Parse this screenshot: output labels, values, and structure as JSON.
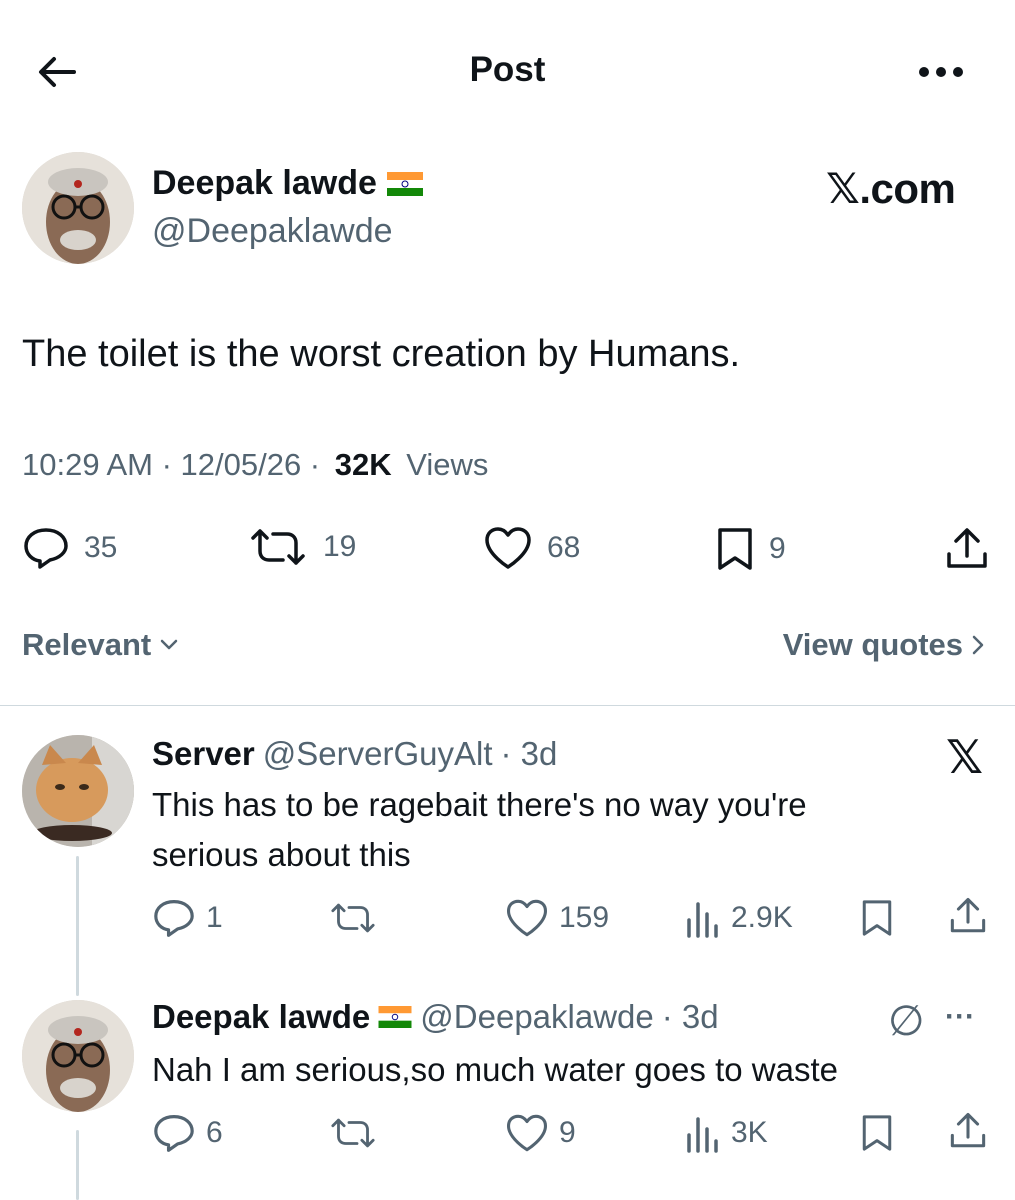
{
  "header": {
    "title": "Post",
    "back_icon": "arrow-left-icon",
    "more_icon": "more-horizontal-icon"
  },
  "post": {
    "author_name": "Deepak lawde",
    "handle": "@Deepaklawde",
    "flag": "india-flag",
    "brand": "𝕏.com",
    "text": "The toilet is the worst creation by Humans.",
    "time": "10:29 AM · 12/05/26 · ",
    "views_count": "32K",
    "views_label": " Views",
    "stats": {
      "replies": "35",
      "reposts": "19",
      "likes": "68",
      "bookmarks": "9"
    }
  },
  "sort": {
    "label": "Relevant",
    "view_quotes": "View quotes"
  },
  "replies": [
    {
      "name": "Server",
      "handle": "@ServerGuyAlt",
      "time": "· 3d",
      "text_line1": "This has to be ragebait there's no way you're",
      "text_line2": "serious about this",
      "replies": "1",
      "likes": "159",
      "views": "2.9K",
      "badge": "𝕏"
    },
    {
      "name": "Deepak lawde",
      "handle": "@Deepaklawde",
      "time": "· 3d",
      "text_line1": "Nah I am serious,so much water goes to waste",
      "replies": "6",
      "likes": "9",
      "views": "3K",
      "badge": "∅",
      "more": "···"
    }
  ],
  "colors": {
    "text": "#0f1419",
    "secondary": "#536471",
    "divider": "#cfd9de"
  }
}
